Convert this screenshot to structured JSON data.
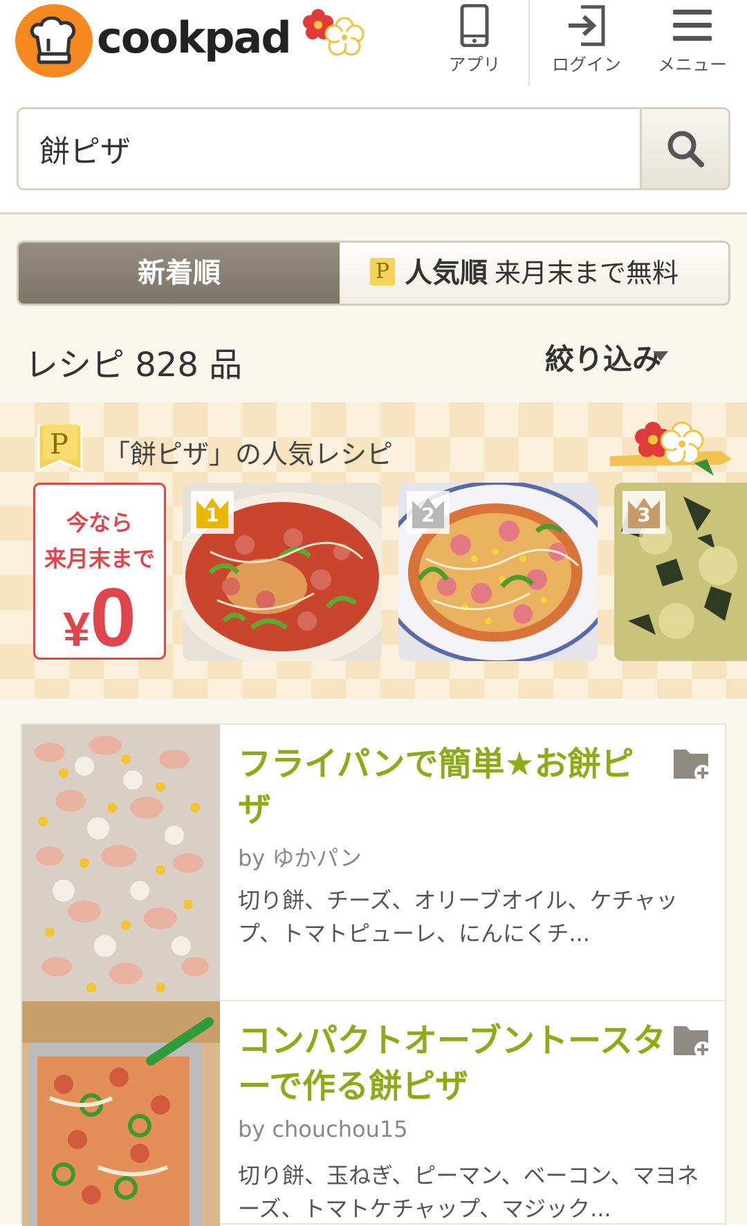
{
  "header": {
    "brand": "cookpad",
    "app_label": "アプリ",
    "login_label": "ログイン",
    "menu_label": "メニュー"
  },
  "search": {
    "query": "餅ピザ"
  },
  "sort": {
    "new_label": "新着順",
    "popular_label": "人気順",
    "popular_note": "来月末まで無料",
    "premium_badge": "P"
  },
  "results": {
    "count_text": "レシピ 828 品",
    "filter_label": "絞り込み"
  },
  "popular": {
    "badge": "P",
    "title": "「餅ピザ」の人気レシピ",
    "promo_line1": "今なら",
    "promo_line2": "来月末まで",
    "promo_yen": "¥",
    "promo_price": "0",
    "ranks": [
      "1",
      "2",
      "3"
    ]
  },
  "recipes": [
    {
      "title": "フライパンで簡単★お餅ピザ",
      "author": "by ゆかパン",
      "ingredients": "切り餅、チーズ、オリーブオイル、ケチャップ、トマトピューレ、にんにくチ..."
    },
    {
      "title": "コンパクトオーブントースターで作る餅ピザ",
      "author": "by chouchou15",
      "ingredients": "切り餅、玉ねぎ、ピーマン、ベーコン、マヨネーズ、トマトケチャップ、マジック..."
    }
  ],
  "colors": {
    "brand_orange": "#f5891f",
    "recipe_title_green": "#8bab17",
    "promo_red": "#e0444c",
    "gold_crown": "#e9b600",
    "silver_crown": "#b8b8b8",
    "bronze_crown": "#c89a6a"
  }
}
